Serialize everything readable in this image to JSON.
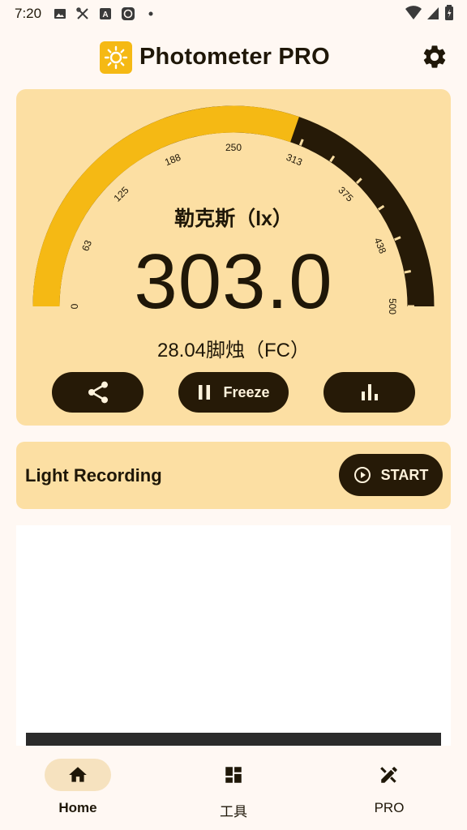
{
  "status_bar": {
    "time": "7:20",
    "icons": [
      "image-icon",
      "tools-icon",
      "font-icon",
      "app-icon",
      "dot-icon"
    ],
    "right_icons": [
      "wifi-icon",
      "signal-icon",
      "battery-icon"
    ]
  },
  "header": {
    "title": "Photometer PRO",
    "logo_icon": "sun-icon",
    "settings_icon": "gear-icon"
  },
  "meter": {
    "unit": "勒克斯（lx）",
    "value": "303.0",
    "secondary": "28.04脚烛（FC）",
    "gauge": {
      "min": 0,
      "max": 500,
      "current": 303.0,
      "tick_labels": [
        "0",
        "63",
        "125",
        "188",
        "250",
        "313",
        "375",
        "438",
        "500"
      ],
      "fill_color": "#F5B914",
      "track_color": "#261A07"
    },
    "actions": {
      "share_icon": "share-icon",
      "freeze_label": "Freeze",
      "freeze_icon": "pause-icon",
      "stats_icon": "bar-chart-icon"
    }
  },
  "recording": {
    "title": "Light Recording",
    "start_label": "START",
    "start_icon": "play-circle-icon"
  },
  "bottom_nav": {
    "items": [
      {
        "label": "Home",
        "icon": "home-icon",
        "active": true
      },
      {
        "label": "工具",
        "icon": "dashboard-icon",
        "active": false
      },
      {
        "label": "PRO",
        "icon": "pencil-ruler-icon",
        "active": false
      }
    ]
  },
  "colors": {
    "background": "#FFF8F3",
    "card": "#FCDFA3",
    "accent": "#F5B914",
    "dark": "#261A07"
  }
}
